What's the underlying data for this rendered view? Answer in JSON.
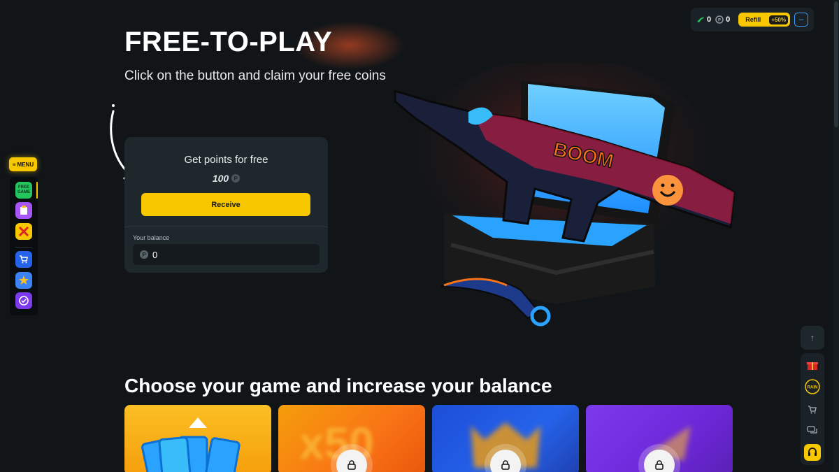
{
  "topbar": {
    "kills": "0",
    "points": "0",
    "refill_label": "Refill",
    "refill_bonus": "+50%"
  },
  "menu": {
    "label": "MENU",
    "items": [
      {
        "name": "free-game",
        "text": "FREE GAME",
        "color": "#22c55e"
      },
      {
        "name": "cases",
        "text": "",
        "color": "#a855f7"
      },
      {
        "name": "battles",
        "text": "",
        "color": "#f7c700"
      },
      {
        "name": "shop",
        "text": "",
        "color": "#2563eb"
      },
      {
        "name": "stars",
        "text": "",
        "color": "#3b82f6"
      },
      {
        "name": "tasks",
        "text": "",
        "color": "#7c3aed"
      }
    ]
  },
  "hero": {
    "title": "FREE-TO-PLAY",
    "subtitle": "Click on the button and claim your free coins"
  },
  "free_card": {
    "title": "Get points for free",
    "amount": "100",
    "button": "Receive",
    "balance_label": "Your balance",
    "balance_value": "0"
  },
  "art": {
    "sticker_text": "BOOM"
  },
  "games_section": {
    "title": "Choose your game and increase your balance",
    "tile_overlay": "x50"
  },
  "colors": {
    "accent": "#f7c700",
    "background": "#111518",
    "card": "#1e272c"
  }
}
